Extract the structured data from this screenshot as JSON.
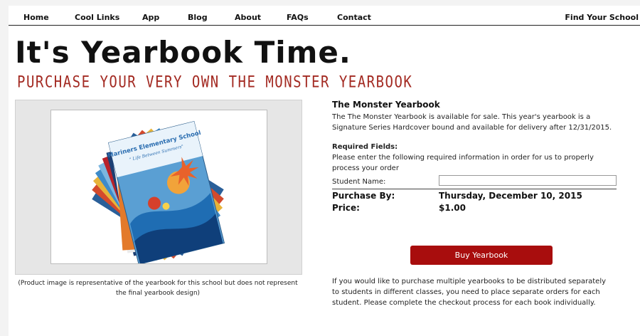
{
  "nav": {
    "items": [
      "Home",
      "Cool Links",
      "App",
      "Blog",
      "About",
      "FAQs",
      "Contact"
    ],
    "right": "Find Your School"
  },
  "hero": {
    "title": "It's Yearbook Time.",
    "subtitle": "PURCHASE YOUR VERY OWN THE MONSTER YEARBOOK"
  },
  "product": {
    "book_school_name": "Mariners Elementary School",
    "book_motto": "\" Life Between Summers\"",
    "caption": "(Product image is representative of the yearbook for this school but does not represent the final yearbook design)"
  },
  "info": {
    "title": "The Monster Yearbook",
    "description": "The The Monster Yearbook is available for sale. This year's yearbook is a Signature Series Hardcover bound and available for delivery after 12/31/2015.",
    "required_label": "Required Fields:",
    "required_text": "Please enter the following required information in order for us to properly process your order",
    "student_name_label": "Student Name:",
    "student_name_value": "",
    "purchase_by_label": "Purchase By:",
    "purchase_by_value": "Thursday, December 10, 2015",
    "price_label": "Price:",
    "price_value": "$1.00",
    "buy_button": "Buy Yearbook",
    "note": "If you would like to purchase multiple yearbooks to be distributed separately to students in different classes, you need to place separate orders for each student. Please complete the checkout process for each book individually."
  },
  "colors": {
    "accent_red": "#a80d0d",
    "subtitle_red": "#a32a22"
  }
}
